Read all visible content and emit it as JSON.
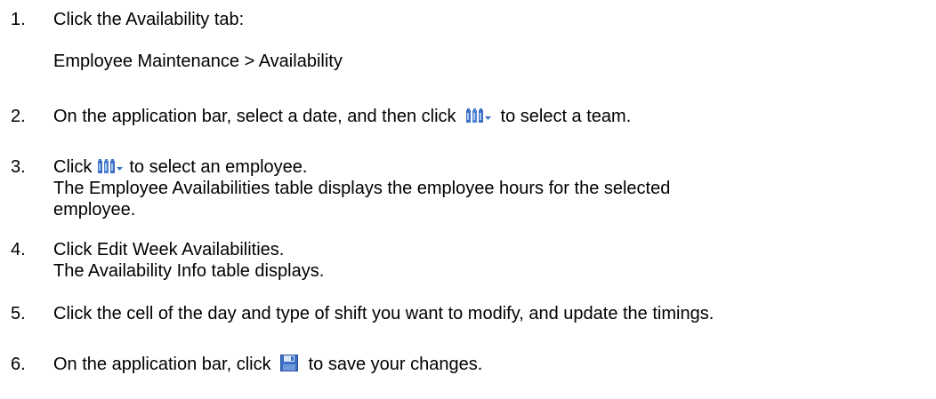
{
  "steps": [
    {
      "number": "1.",
      "text": "Click the Availability tab:",
      "path": "Employee Maintenance > Availability"
    },
    {
      "number": "2.",
      "before": "On the application bar, select a date, and then click",
      "icon": "team-select-icon",
      "after": "to select a team."
    },
    {
      "number": "3.",
      "before": "Click",
      "icon": "team-select-icon",
      "after": "to select an employee.",
      "detail_line1": "The Employee Availabilities table displays the employee hours for the selected",
      "detail_line2": "employee."
    },
    {
      "number": "4.",
      "text": "Click Edit Week Availabilities.",
      "detail": "The Availability Info table displays."
    },
    {
      "number": "5.",
      "text": "Click the cell of the day and type of shift you want to modify, and update the timings."
    },
    {
      "number": "6.",
      "before": "On the application bar, click",
      "icon": "save-icon",
      "after": "to save your changes."
    }
  ],
  "colors": {
    "text": "#000000",
    "icon_blue": "#3a6fc4",
    "icon_light": "#a9c6ef"
  }
}
